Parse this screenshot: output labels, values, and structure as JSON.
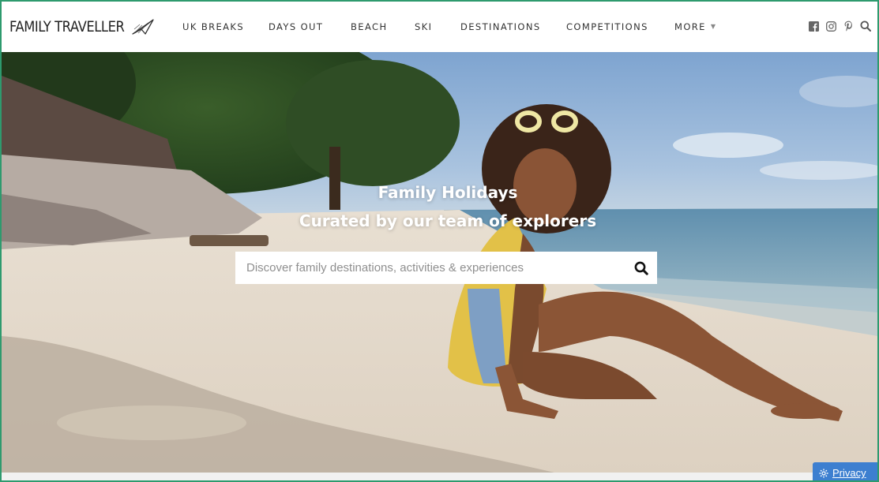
{
  "header": {
    "logo_text": "FAMILY TRAVELLER",
    "nav": [
      {
        "label": "UK BREAKS"
      },
      {
        "label": "DAYS OUT"
      },
      {
        "label": "BEACH"
      },
      {
        "label": "SKI"
      },
      {
        "label": "DESTINATIONS"
      },
      {
        "label": "COMPETITIONS"
      },
      {
        "label": "MORE"
      }
    ],
    "social_icons": [
      "facebook-icon",
      "instagram-icon",
      "pinterest-icon",
      "search-icon"
    ]
  },
  "hero": {
    "title_line1": "Family Holidays",
    "title_line2": "Curated by our team of explorers",
    "search": {
      "placeholder": "Discover family destinations, activities & experiences",
      "value": ""
    }
  },
  "privacy": {
    "label": "Privacy"
  },
  "colors": {
    "frame_border": "#2e9a6e",
    "privacy_bg": "#3d7fd0"
  }
}
